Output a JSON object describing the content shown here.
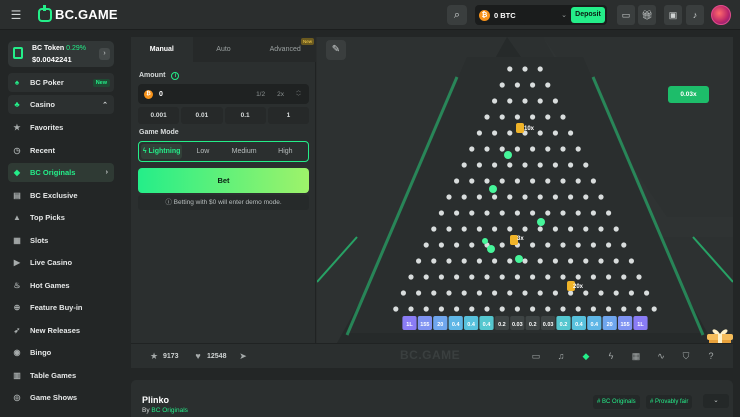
{
  "header": {
    "logo_text": "BC.GAME",
    "wallet_amount": "0 BTC",
    "wallet_currency_icon": "bitcoin-icon",
    "deposit_label": "Deposit"
  },
  "sidebar": {
    "token": {
      "name": "BC Token",
      "change": "0.29%",
      "price": "$0.0042241"
    },
    "items": [
      {
        "label": "BC Poker",
        "icon": "poker-icon",
        "badge": "New"
      },
      {
        "label": "Casino",
        "icon": "casino-icon"
      },
      {
        "label": "Favorites",
        "icon": "star-icon"
      },
      {
        "label": "Recent",
        "icon": "clock-icon"
      },
      {
        "label": "BC Originals",
        "icon": "bc-originals-icon"
      },
      {
        "label": "BC Exclusive",
        "icon": "exclusive-icon"
      },
      {
        "label": "Top Picks",
        "icon": "thumbs-up-icon"
      },
      {
        "label": "Slots",
        "icon": "slots-icon"
      },
      {
        "label": "Live Casino",
        "icon": "live-icon"
      },
      {
        "label": "Hot Games",
        "icon": "fire-icon"
      },
      {
        "label": "Feature Buy-in",
        "icon": "buy-in-icon"
      },
      {
        "label": "New Releases",
        "icon": "rocket-icon"
      },
      {
        "label": "Bingo",
        "icon": "bingo-icon"
      },
      {
        "label": "Table Games",
        "icon": "table-games-icon"
      },
      {
        "label": "Game Shows",
        "icon": "game-shows-icon"
      }
    ]
  },
  "controls": {
    "tabs": [
      {
        "label": "Manual"
      },
      {
        "label": "Auto"
      },
      {
        "label": "Advanced",
        "badge": "New"
      }
    ],
    "amount_label": "Amount",
    "amount_value": "0",
    "half_label": "1/2",
    "double_label": "2x",
    "presets": [
      "0.001",
      "0.01",
      "0.1",
      "1"
    ],
    "game_mode_label": "Game Mode",
    "modes": [
      "Lightning",
      "Low",
      "Medium",
      "High"
    ],
    "bet_label": "Bet",
    "demo_note": "Betting with $0 will enter demo mode."
  },
  "board": {
    "last_multiplier": "0.03x",
    "slots": [
      "1L",
      "155",
      "20",
      "0.4",
      "0.4",
      "0.4",
      "0.2",
      "0.03",
      "0.2",
      "0.03",
      "0.2",
      "0.4",
      "0.4",
      "20",
      "155",
      "1L"
    ],
    "boosts": [
      "10x",
      "3x",
      "20x"
    ],
    "watermark": "BC.GAME"
  },
  "footer_bar": {
    "favorites_count": "9173",
    "likes_count": "12548"
  },
  "game_info": {
    "title": "Plinko",
    "by_prefix": "By",
    "provider": "BC Originals",
    "tags": [
      "# BC Originals",
      "# Provably fair"
    ]
  },
  "colors": {
    "accent": "#24ee89",
    "background": "#232626",
    "panel": "#2b2f2f"
  }
}
